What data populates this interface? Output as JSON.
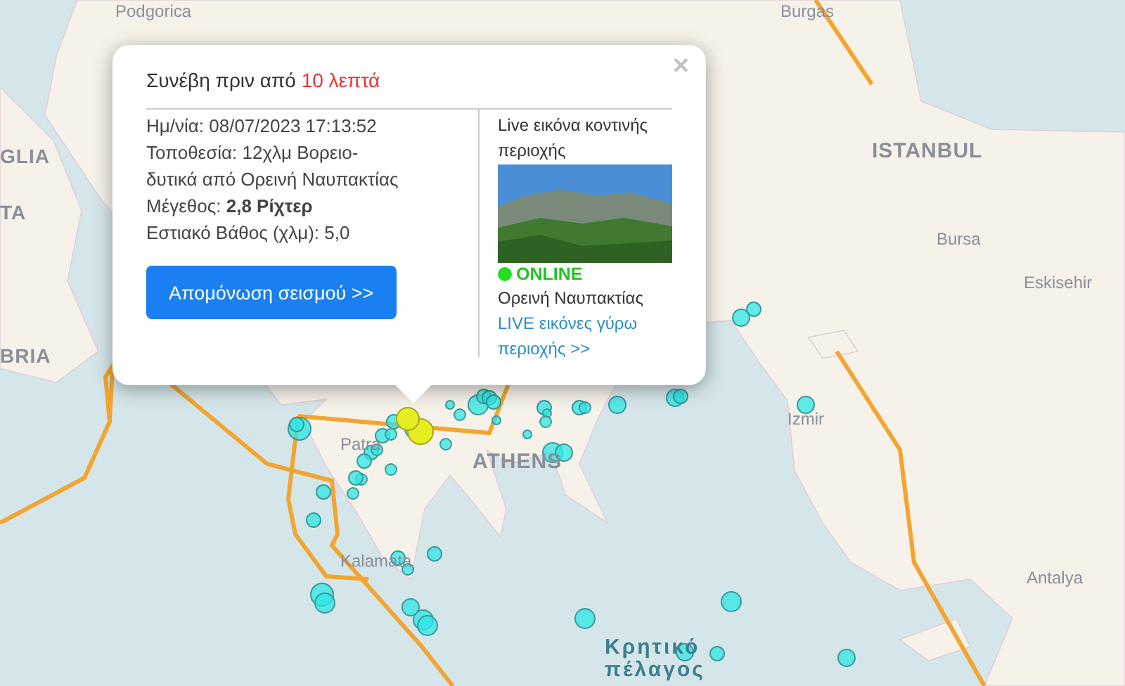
{
  "map": {
    "labels": [
      {
        "text": "Podgorica",
        "kind": "city"
      },
      {
        "text": "Burgas",
        "kind": "city"
      },
      {
        "text": "GLIA",
        "kind": "country"
      },
      {
        "text": "TA",
        "kind": "country"
      },
      {
        "text": "BRIA",
        "kind": "country"
      },
      {
        "text": "ISTANBUL",
        "kind": "capital"
      },
      {
        "text": "Bursa",
        "kind": "city"
      },
      {
        "text": "Eskisehir",
        "kind": "city"
      },
      {
        "text": "Izmir",
        "kind": "city"
      },
      {
        "text": "Patra",
        "kind": "city"
      },
      {
        "text": "ATHENS",
        "kind": "capital"
      },
      {
        "text": "Kalamata",
        "kind": "city"
      },
      {
        "text": "Antalya",
        "kind": "city"
      },
      {
        "text": "Κρητικό",
        "kind": "sea"
      },
      {
        "text": "πέλαγος",
        "kind": "sea"
      }
    ]
  },
  "popup": {
    "close": "×",
    "headline": "Συνέβη πριν από ",
    "ago": "10 λεπτά",
    "details": [
      "Ημ/νία: 08/07/2023 17:13:52",
      "Τοποθεσία: 12χλμ Βορειο-δυτικά από Ορεινή Ναυπακτίας",
      "Μέγεθος: **2,8 Ρίχτερ**",
      "Εστιακό Βάθος (χλμ): 5,0"
    ],
    "button": "Απομόνωση σεισμού >>",
    "webcam": {
      "title": "Live εικόνα κοντινής περιοχής",
      "online": true,
      "status": "ONLINE",
      "place": "Ορεινή Ναυπακτίας",
      "link": "LIVE εικόνες γύρω περιοχής >>"
    }
  }
}
